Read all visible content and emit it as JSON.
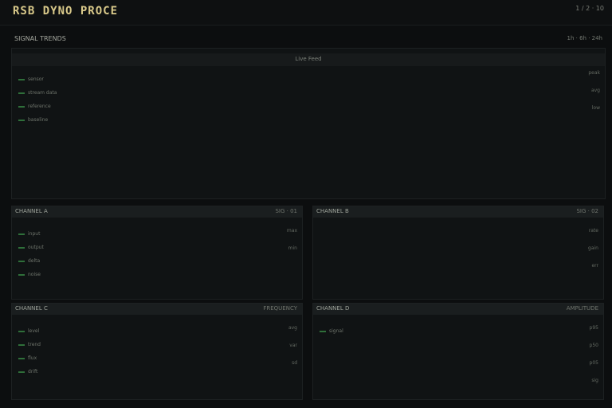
{
  "app": {
    "title": "RSB DYNO PROCE",
    "status": "1 / 2 · 10"
  },
  "main_panel": {
    "title": "SIGNAL TRENDS",
    "meta": "1h · 6h · 24h",
    "subtitle": "Live Feed",
    "legend": [
      "sensor",
      "stream data",
      "reference",
      "baseline"
    ],
    "right_labels": [
      "peak",
      "avg",
      "low"
    ],
    "colors": {
      "line": "#1f5a2f",
      "fill": "#123a1e"
    }
  },
  "panels": [
    {
      "title": "CHANNEL A",
      "meta": "SIG · 01",
      "legend": [
        "input",
        "output",
        "delta",
        "noise"
      ],
      "right_labels": [
        "max",
        "min"
      ],
      "colors": {
        "line": "#2c7a3a",
        "fill": "#1d5a2a"
      }
    },
    {
      "title": "CHANNEL B",
      "meta": "SIG · 02",
      "legend": [],
      "right_labels": [
        "rate",
        "gain",
        "err"
      ],
      "colors": {
        "line": "#2a7036",
        "fill": "#184e24"
      }
    },
    {
      "title": "CHANNEL C",
      "meta": "FREQUENCY",
      "legend": [
        "level",
        "trend",
        "flux",
        "drift"
      ],
      "right_labels": [
        "avg",
        "var",
        "sd"
      ],
      "colors": {
        "line": "#183f22",
        "fill": "#10301a"
      }
    },
    {
      "title": "CHANNEL D",
      "meta": "AMPLITUDE",
      "legend": [
        "signal"
      ],
      "right_labels": [
        "p95",
        "p50",
        "p05",
        "sig"
      ],
      "colors": {
        "line": "#1e4a2a",
        "fill": "#123a1d"
      }
    }
  ]
}
